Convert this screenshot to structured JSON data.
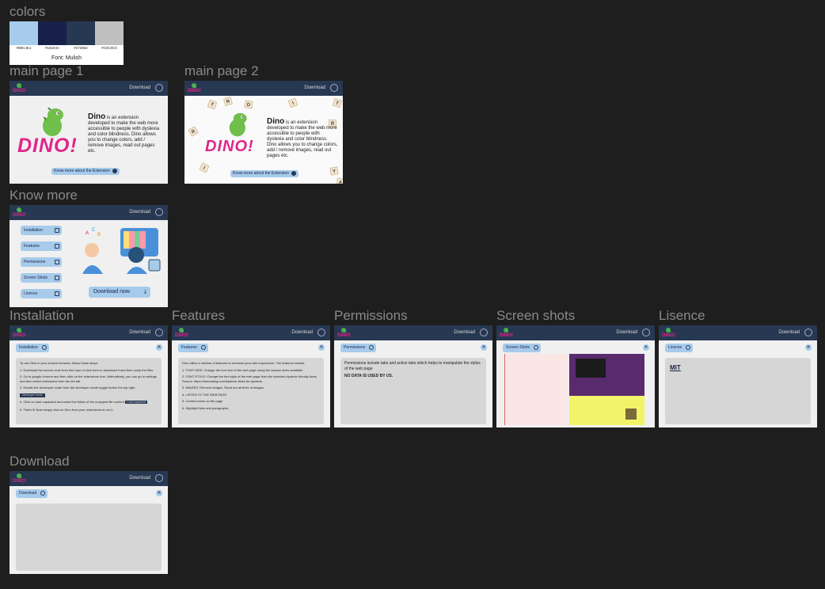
{
  "sections": {
    "colors": "colors",
    "main1": "main page 1",
    "main2": "main page 2",
    "know_more": "Know more",
    "installation": "Installation",
    "features": "Features",
    "permissions": "Permissions",
    "screen_shots": "Screen shots",
    "lisence": "Lisence",
    "download": "Download"
  },
  "palette": {
    "swatches": [
      {
        "hex": "#A7CBEA",
        "label": "#89C4E1"
      },
      {
        "hex": "#18204A",
        "label": "#18204A"
      },
      {
        "hex": "#273852",
        "label": "#273852"
      },
      {
        "hex": "#C0C0C0",
        "label": "#C0C0C0"
      }
    ],
    "font_label": "Font: Mulish"
  },
  "header": {
    "logo": "DINO!",
    "download": "Download"
  },
  "hero": {
    "dino_title": "DINO!",
    "desc_title": "Dino",
    "desc_body": " is an extension developed to make the web more accessible to people with dyslexia and color blindness. Dino allows you to change colors, add / remove images, read out pages etc.",
    "cta": "Know more about the Extension"
  },
  "know_more": {
    "menu": [
      "Installation",
      "Features",
      "Permissions",
      "Screen Shots",
      "Licence"
    ],
    "download_now": "Download now"
  },
  "installation": {
    "tab": "Installation",
    "intro": "To use Dino in your chrome browser, follow these steps:",
    "steps": [
      "1. Download the source code from this repo or click here to download it and then unzip the files.",
      "2. Go to google chrome and then click on the extensions icon. Alternatively, you can go to settings and then select extensions from the left tab.",
      "3. Enable the developer mode from the developer mode toggle button the top right",
      "4. Click on load unpacked and select the folder of the unzipped file content",
      "5. That's it! Now simply click on Dino from your extensions to run it."
    ],
    "dev_mode": "Developer mode",
    "load_unpacked": "Load unpacked"
  },
  "features": {
    "tab": "Features",
    "intro": "Dino offers a number of features to enhance your web experience. The features include",
    "items": [
      "1. FONT SIZE: Change the font size of the web page using the various sizes available.",
      "2. FONT STYLE: Change the font style of the web page from the selected dyslexic friendly fonts. Source: https://irisreading.com/dyslexic-fonts-for-dyslexia",
      "3. IMAGES: Remove images. Read out alt texts of images.",
      "4. LISTEN TO THE WEB PAGE",
      "5. Control colors on the page",
      "6. Highlight links and paragraphs."
    ]
  },
  "permissions": {
    "tab": "Permissions",
    "text": "Permissions include tabs and active tabs which helps to manipulate the styles of the web page",
    "no_data": "NO DATA IS USED BY US."
  },
  "screenshots": {
    "tab": "Screen Shots"
  },
  "license": {
    "tab": "License",
    "value": "MIT"
  },
  "download": {
    "tab": "Download"
  }
}
